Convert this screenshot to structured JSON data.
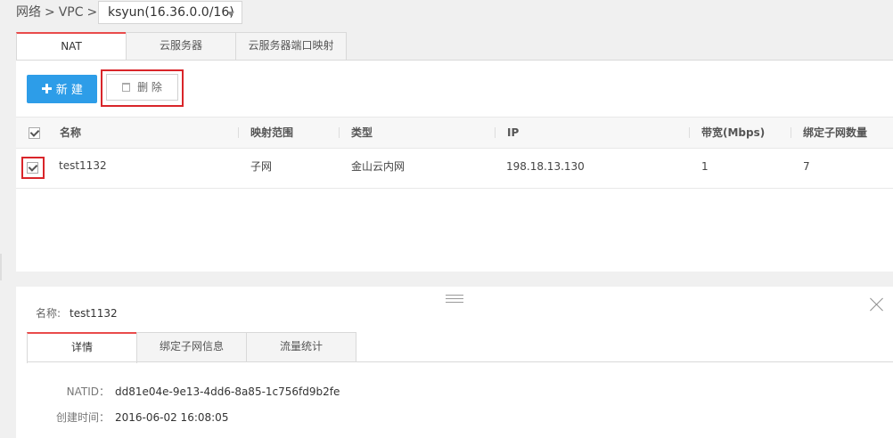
{
  "breadcrumb": {
    "part1": "网络",
    "sep1": ">",
    "part2": "VPC",
    "sep2": ">"
  },
  "vpc_select": {
    "value": "ksyun(16.36.0.0/16)"
  },
  "top_tabs": [
    {
      "label": "NAT",
      "active": true
    },
    {
      "label": "云服务器",
      "active": false
    },
    {
      "label": "云服务器端口映射",
      "active": false
    }
  ],
  "toolbar": {
    "new_label": "新 建",
    "delete_label": "删 除"
  },
  "table": {
    "columns": [
      "名称",
      "映射范围",
      "类型",
      "IP",
      "带宽(Mbps)",
      "绑定子网数量"
    ],
    "rows": [
      {
        "name": "test1132",
        "scope": "子网",
        "type": "金山云内网",
        "ip": "198.18.13.130",
        "bandwidth": "1",
        "subnets": "7",
        "checked": true
      }
    ]
  },
  "detail": {
    "name_label": "名称:",
    "name_value": "test1132",
    "tabs": [
      {
        "label": "详情",
        "active": true
      },
      {
        "label": "绑定子网信息",
        "active": false
      },
      {
        "label": "流量统计",
        "active": false
      }
    ],
    "fields": [
      {
        "label": "NATID：",
        "value": "dd81e04e-9e13-4dd6-8a85-1c756fd9b2fe"
      },
      {
        "label": "创建时间：",
        "value": "2016-06-02 16:08:05"
      }
    ]
  },
  "colors": {
    "accent_blue": "#2d9de8",
    "active_tab_red": "#e94b4b",
    "highlight_box_red": "#d9252a"
  }
}
